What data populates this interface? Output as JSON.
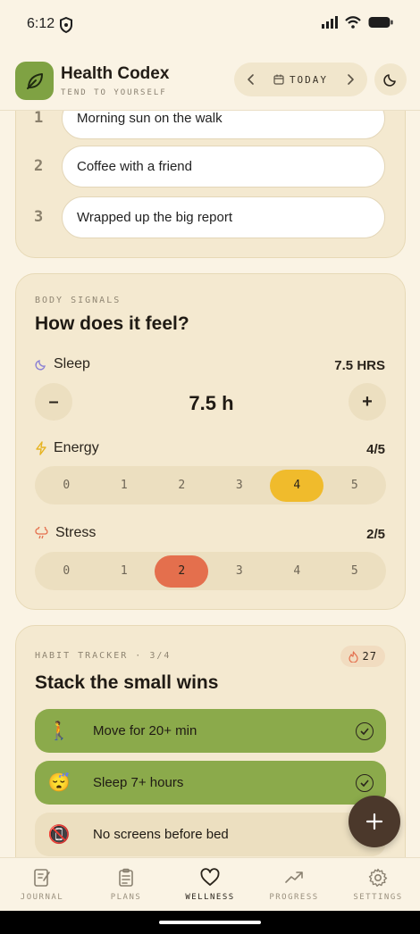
{
  "status": {
    "time": "6:12"
  },
  "header": {
    "app_title": "Health Codex",
    "tagline": "TEND TO YOURSELF",
    "date_label": "TODAY"
  },
  "gratitude": {
    "items": [
      {
        "num": "1",
        "text": "Morning sun on the walk"
      },
      {
        "num": "2",
        "text": "Coffee with a friend"
      },
      {
        "num": "3",
        "text": "Wrapped up the big report"
      }
    ]
  },
  "signals": {
    "eyebrow": "BODY SIGNALS",
    "title": "How does it feel?",
    "sleep": {
      "label": "Sleep",
      "value": "7.5 HRS",
      "display": "7.5 h",
      "minus": "–",
      "plus": "+"
    },
    "energy": {
      "label": "Energy",
      "value": "4/5",
      "selected": 4
    },
    "stress": {
      "label": "Stress",
      "value": "2/5",
      "selected": 2
    },
    "scale": [
      "0",
      "1",
      "2",
      "3",
      "4",
      "5"
    ]
  },
  "habits": {
    "eyebrow": "HABIT TRACKER · 3/4",
    "title": "Stack the small wins",
    "streak": "27",
    "items": [
      {
        "emoji": "🚶",
        "label": "Move for 20+ min",
        "done": true
      },
      {
        "emoji": "😴",
        "label": "Sleep 7+ hours",
        "done": true
      },
      {
        "emoji": "📵",
        "label": "No screens before bed",
        "done": false
      }
    ]
  },
  "nav": {
    "items": [
      {
        "label": "JOURNAL",
        "icon": "journal-icon"
      },
      {
        "label": "PLANS",
        "icon": "clipboard-icon"
      },
      {
        "label": "WELLNESS",
        "icon": "heart-icon",
        "active": true
      },
      {
        "label": "PROGRESS",
        "icon": "trend-icon"
      },
      {
        "label": "SETTINGS",
        "icon": "gear-icon"
      }
    ]
  },
  "colors": {
    "background": "#faf3e4",
    "accent_green": "#7fa243",
    "energy_yellow": "#f0bb2c",
    "stress_orange": "#e46f4d",
    "fab_brown": "#4b382b"
  }
}
